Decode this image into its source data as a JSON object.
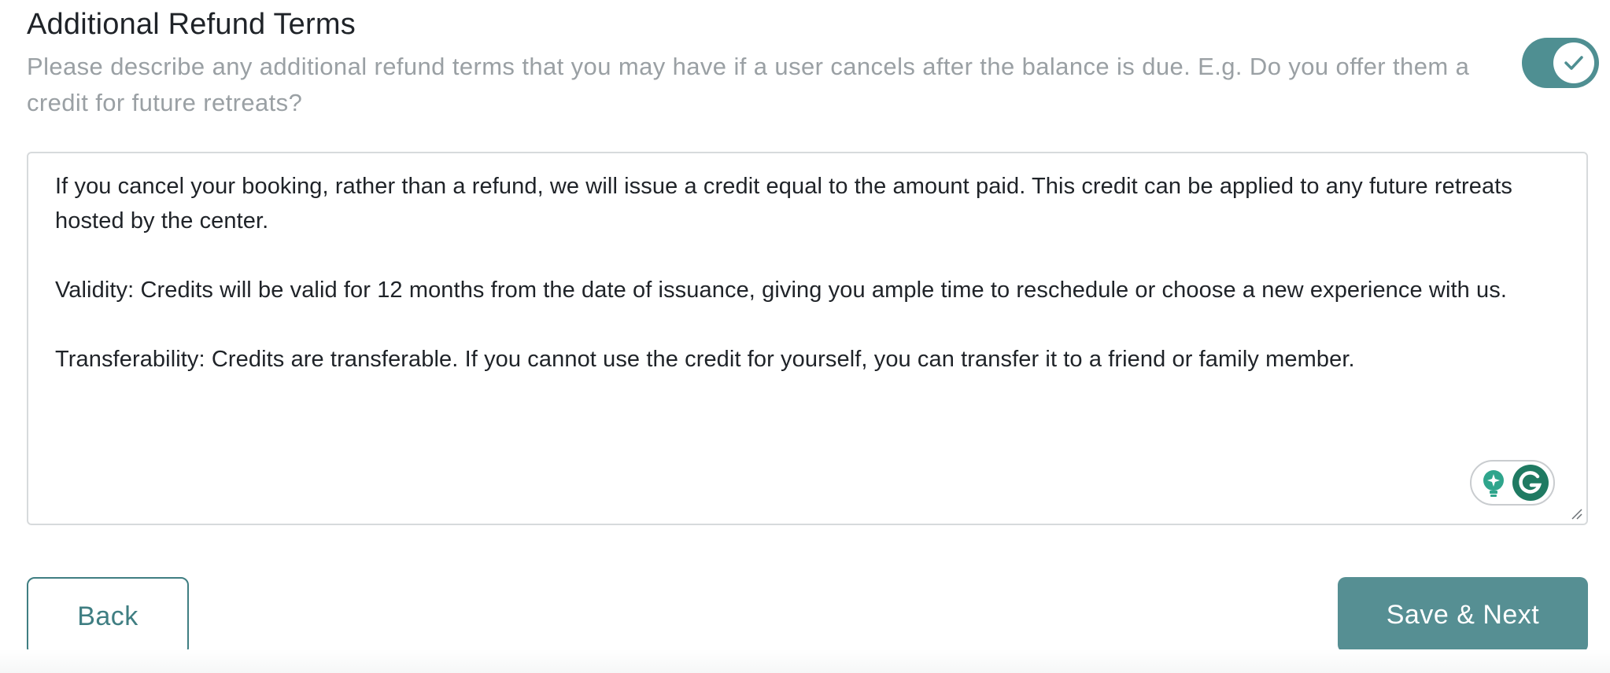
{
  "section": {
    "title": "Additional Refund Terms",
    "description": "Please describe any additional refund terms that you may have if a user cancels after the balance is due. E.g. Do you offer them a credit for future retreats?",
    "toggle_enabled": true
  },
  "refund_terms": {
    "value": "If you cancel your booking, rather than a refund, we will issue a credit equal to the amount paid. This credit can be applied to any future retreats hosted by the center.\n\nValidity: Credits will be valid for 12 months from the date of issuance, giving you ample time to reschedule or choose a new experience with us.\n\nTransferability: Credits are transferable. If you cannot use the credit for yourself, you can transfer it to a friend or family member."
  },
  "icons": {
    "toggle": "checkmark-icon",
    "assistant": "lightbulb-sparkle-icon",
    "grammarly": "grammarly-g-icon",
    "resize": "resize-handle-icon"
  },
  "colors": {
    "accent": "#568f93",
    "accent_dark": "#3f7e82",
    "text": "#1f2328",
    "muted": "#9aa0a4",
    "border": "#d7dadc"
  },
  "footer": {
    "back_label": "Back",
    "save_label": "Save & Next"
  }
}
